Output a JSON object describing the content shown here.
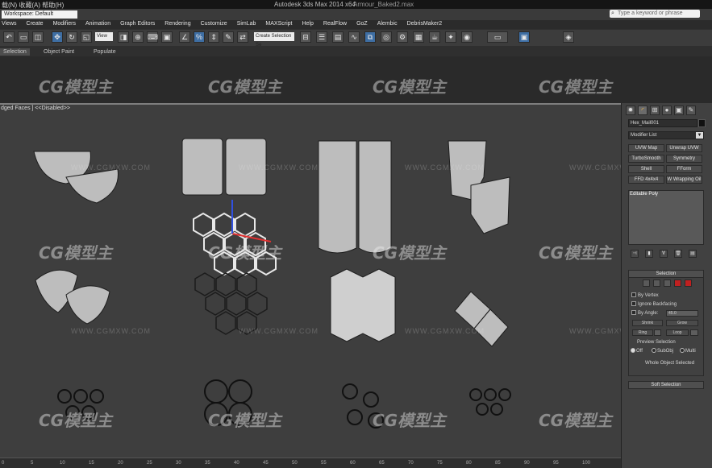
{
  "titlebar": {
    "menu_text": "载(N)   收藏(A)   帮助(H)",
    "app_title": "Autodesk 3ds Max  2014 x64",
    "file_name": "Armour_Baked2.max",
    "search_placeholder": "Type a keyword or phrase"
  },
  "workspace": {
    "label": "Workspace: Default"
  },
  "menu": {
    "items": [
      "Views",
      "Create",
      "Modifiers",
      "Animation",
      "Graph Editors",
      "Rendering",
      "Customize",
      "SimLab",
      "MAXScript",
      "Help",
      "RealFlow",
      "GoZ",
      "Alembic",
      "DebrisMaker2"
    ]
  },
  "toolbar": {
    "view_dropdown": "View",
    "selection_set": "Create Selection Se"
  },
  "ribbon": {
    "tabs": [
      "Selection",
      "Object Paint",
      "Populate"
    ],
    "active_tab": "Selection"
  },
  "viewport": {
    "label": "dged Faces ]  <<Disabled>>"
  },
  "timeline": {
    "ticks": [
      "0",
      "5",
      "10",
      "15",
      "20",
      "25",
      "30",
      "35",
      "40",
      "45",
      "50",
      "55",
      "60",
      "65",
      "70",
      "75",
      "80",
      "85",
      "90",
      "95",
      "100"
    ]
  },
  "command_panel": {
    "object_name": "Hex_Mail001",
    "modifier_list": "Modifier List",
    "modifier_buttons": [
      "UVW Map",
      "Unwrap UVW",
      "TurboSmooth",
      "Symmetry",
      "Shell",
      "FForm",
      "FFD 4x4x4",
      "W Wrapping Oil"
    ],
    "stack_item": "Editable Poly",
    "selection_rollout": "Selection",
    "by_vertex": "By Vertex",
    "ignore_backfacing": "Ignore Backfacing",
    "by_angle": "By Angle:",
    "angle_value": "45.0",
    "shrink": "Shrink",
    "grow": "Grow",
    "ring": "Ring",
    "loop": "Loop",
    "preview_selection": "Preview Selection",
    "preview_options": [
      "Off",
      "SubObj",
      "Multi"
    ],
    "whole_object": "Whole Object Selected",
    "soft_selection": "Soft Selection"
  },
  "watermark": {
    "logo": "CG模型主",
    "url": "WWW.CGMXW.COM"
  }
}
